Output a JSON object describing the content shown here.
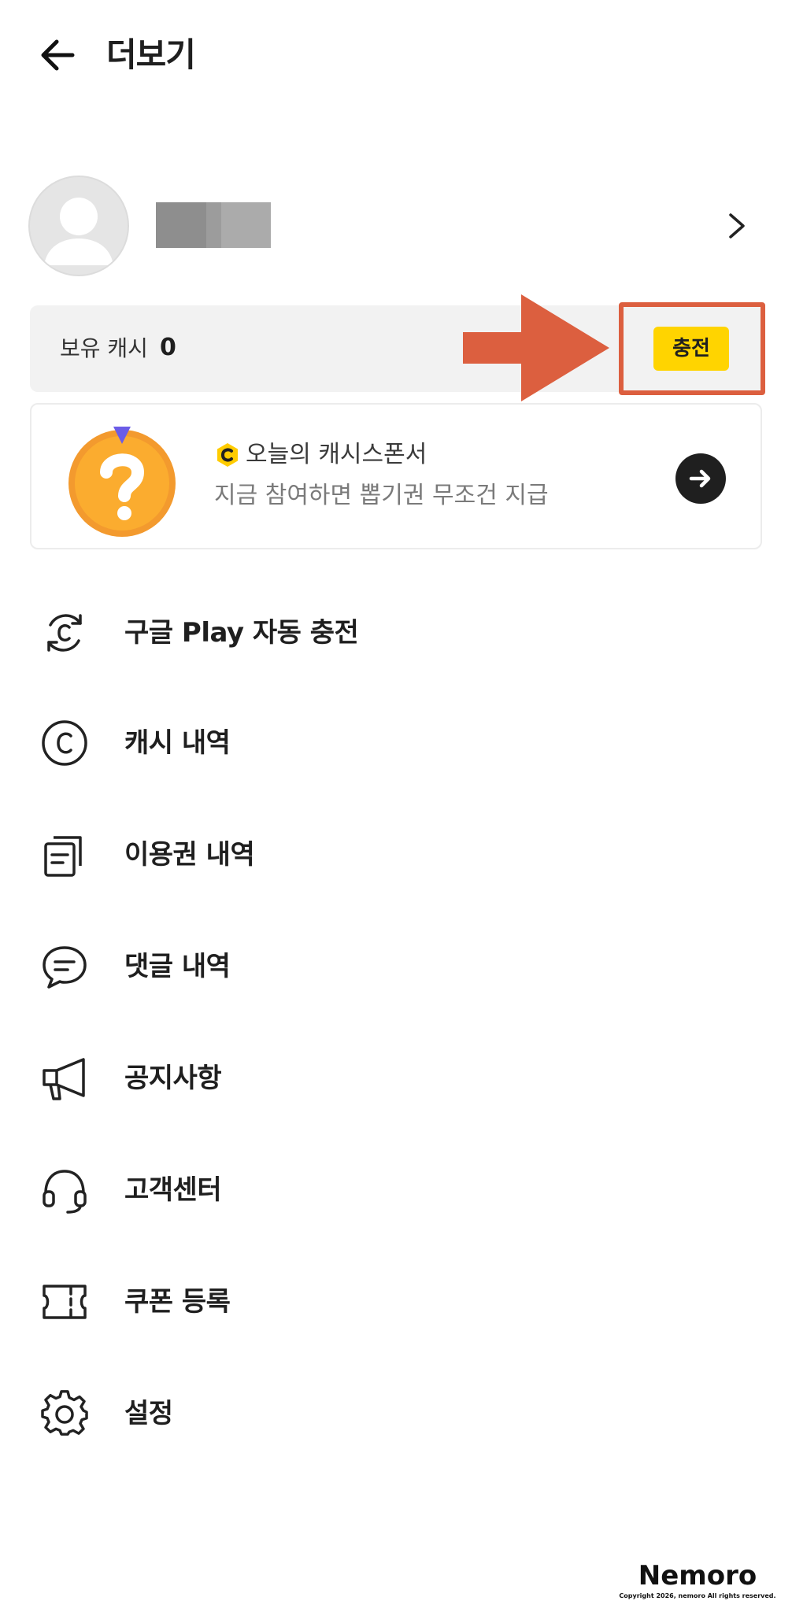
{
  "header": {
    "title": "더보기",
    "back_icon": "arrow-left-icon"
  },
  "profile": {
    "avatar_icon": "default-avatar-icon",
    "nickname_redacted": true,
    "chevron_icon": "chevron-right-icon"
  },
  "cash": {
    "label": "보유 캐시",
    "value": "0",
    "charge_label": "충전",
    "highlight_color": "#dc5f3f",
    "charge_color": "#ffd400"
  },
  "sponsor": {
    "title": "오늘의 캐시스폰서",
    "subtitle": "지금 참여하면 뽑기권 무조건 지급",
    "badge_icon": "question-badge-icon",
    "coin_icon": "cash-coin-icon",
    "go_icon": "arrow-right-circle-icon"
  },
  "menu": {
    "items": [
      {
        "label": "구글 Play 자동 충전",
        "icon": "auto-charge-icon"
      },
      {
        "label": "캐시 내역",
        "icon": "cash-icon"
      },
      {
        "label": "이용권 내역",
        "icon": "ticket-history-icon"
      },
      {
        "label": "댓글 내역",
        "icon": "comment-icon"
      },
      {
        "label": "공지사항",
        "icon": "megaphone-icon"
      },
      {
        "label": "고객센터",
        "icon": "headset-icon"
      },
      {
        "label": "쿠폰 등록",
        "icon": "coupon-icon"
      },
      {
        "label": "설정",
        "icon": "gear-icon"
      }
    ]
  },
  "watermark": {
    "logo": "Nemoro",
    "copyright": "Copyright 2026, nemoro All rights reserved."
  }
}
